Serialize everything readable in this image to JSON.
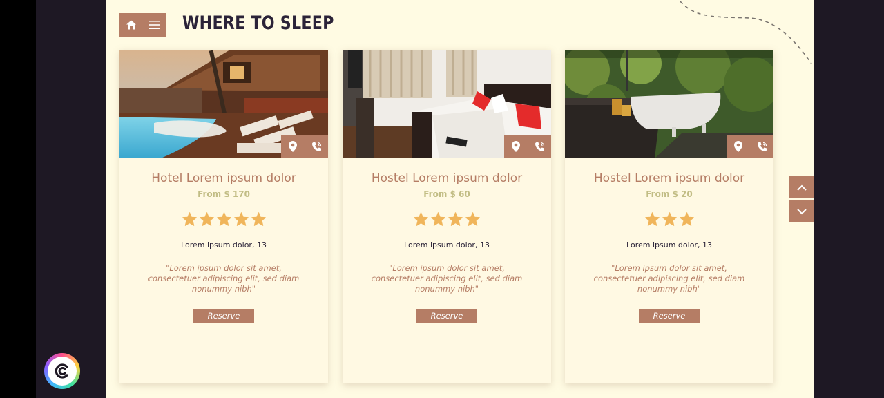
{
  "header": {
    "title": "WHERE TO SLEEP",
    "home_icon": "home-icon",
    "menu_icon": "menu-icon"
  },
  "colors": {
    "accent": "#b57d65",
    "background": "#fffbe3",
    "star": "#f0b55b",
    "price": "#c2bd85",
    "title": "#2b2338"
  },
  "cards": [
    {
      "name": "Hotel Lorem ipsum dolor",
      "price": "From $ 170",
      "stars": 5,
      "address": "Lorem ipsum dolor, 13",
      "quote": "\"Lorem ipsum dolor sit amet, consectetuer adipiscing elit, sed diam nonummy nibh\"",
      "reserve_label": "Reserve"
    },
    {
      "name": "Hostel Lorem ipsum dolor",
      "price": "From $ 60",
      "stars": 4,
      "address": "Lorem ipsum dolor, 13",
      "quote": "\"Lorem ipsum dolor sit amet, consectetuer adipiscing elit, sed diam nonummy nibh\"",
      "reserve_label": "Reserve"
    },
    {
      "name": "Hostel Lorem ipsum dolor",
      "price": "From $ 20",
      "stars": 3,
      "address": "Lorem ipsum dolor, 13",
      "quote": "\"Lorem ipsum dolor sit amet, consectetuer adipiscing elit, sed diam nonummy nibh\"",
      "reserve_label": "Reserve"
    }
  ],
  "scroll": {
    "up_icon": "chevron-up-icon",
    "down_icon": "chevron-down-icon"
  }
}
